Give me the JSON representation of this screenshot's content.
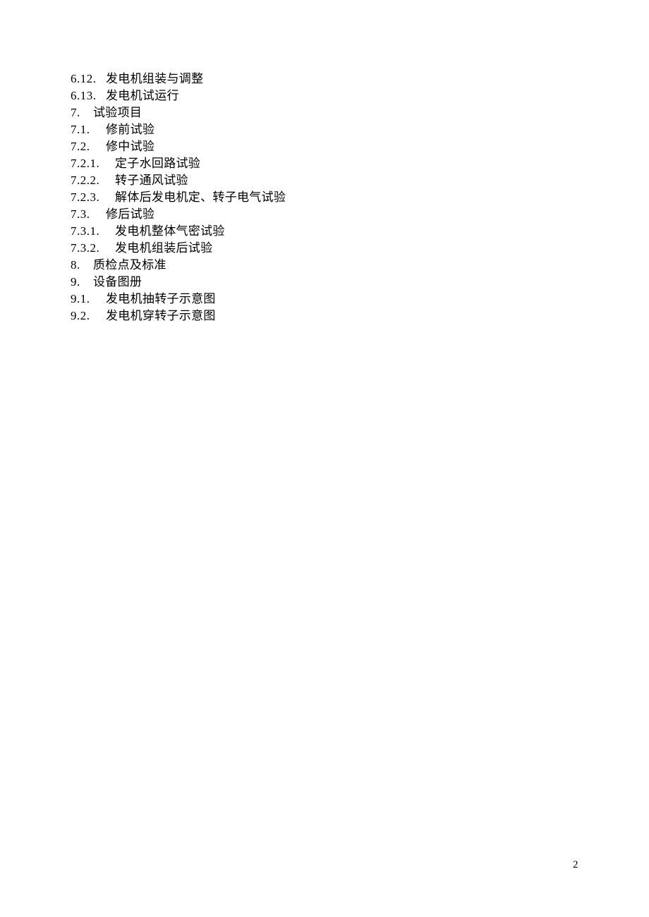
{
  "document": {
    "toc_entries": [
      {
        "number": "6.12.",
        "title": "发电机组装与调整",
        "level": "lvl2b"
      },
      {
        "number": "6.13.",
        "title": "发电机试运行",
        "level": "lvl2b"
      },
      {
        "number": "7.",
        "title": "试验项目",
        "level": "lvl1"
      },
      {
        "number": "7.1.",
        "title": "修前试验",
        "level": "lvl2"
      },
      {
        "number": "7.2.",
        "title": "修中试验",
        "level": "lvl2"
      },
      {
        "number": "7.2.1.",
        "title": "定子水回路试验",
        "level": "lvl3"
      },
      {
        "number": "7.2.2.",
        "title": "转子通风试验",
        "level": "lvl3"
      },
      {
        "number": "7.2.3.",
        "title": "解体后发电机定、转子电气试验",
        "level": "lvl3"
      },
      {
        "number": "7.3.",
        "title": "修后试验",
        "level": "lvl2"
      },
      {
        "number": "7.3.1.",
        "title": "发电机整体气密试验",
        "level": "lvl3"
      },
      {
        "number": "7.3.2.",
        "title": "发电机组装后试验",
        "level": "lvl3"
      },
      {
        "number": "8.",
        "title": "质检点及标准",
        "level": "lvl1"
      },
      {
        "number": "9.",
        "title": "设备图册",
        "level": "lvl1"
      },
      {
        "number": "9.1.",
        "title": "发电机抽转子示意图",
        "level": "lvl2"
      },
      {
        "number": "9.2.",
        "title": "发电机穿转子示意图",
        "level": "lvl2"
      }
    ],
    "page_number": "2"
  }
}
